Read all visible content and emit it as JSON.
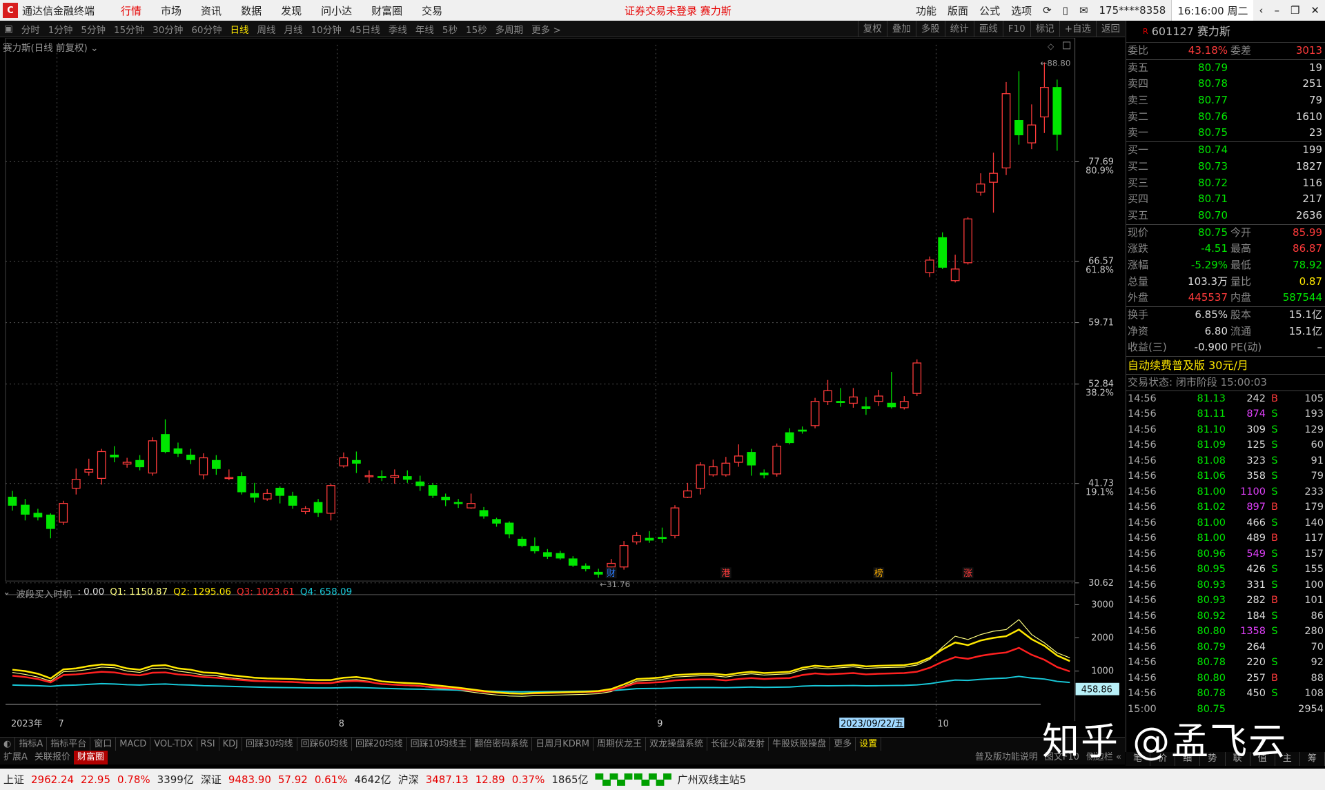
{
  "title": {
    "app_name": "通达信金融终端",
    "menu": [
      "行情",
      "市场",
      "资讯",
      "数据",
      "发现",
      "问小达",
      "财富圈",
      "交易"
    ],
    "active_menu": "行情",
    "notice": "证券交易未登录  赛力斯",
    "right_menu": [
      "功能",
      "版面",
      "公式",
      "选项"
    ],
    "account": "175****8358",
    "clock": "16:16:00 周二"
  },
  "periods": [
    "分时",
    "1分钟",
    "5分钟",
    "15分钟",
    "30分钟",
    "60分钟",
    "日线",
    "周线",
    "月线",
    "10分钟",
    "45日线",
    "季线",
    "年线",
    "5秒",
    "15秒",
    "多周期",
    "更多 >"
  ],
  "active_period": "日线",
  "chart_buttons": [
    "复权",
    "叠加",
    "多股",
    "统计",
    "画线",
    "F10",
    "标记",
    "+自选",
    "返回"
  ],
  "main_legend": "赛力斯(日线 前复权)",
  "indicator_legend": {
    "name": "波段买入时机",
    "v0": ": 0.00",
    "q1": "Q1: 1150.87",
    "q2": "Q2: 1295.06",
    "q3": "Q3: 1023.61",
    "q4": "Q4: 658.09"
  },
  "colors": {
    "up": "#ff3b3b",
    "down": "#00e600",
    "q1": "#ffff80",
    "q2": "#ffe800",
    "q3": "#ff2020",
    "q4": "#18c8d8"
  },
  "stock": {
    "code": "601127",
    "name": "赛力斯",
    "weibi_label": "委比",
    "weibi": "43.18%",
    "weicha_label": "委差",
    "weicha": "3013",
    "asks": [
      {
        "label": "卖五",
        "price": "80.79",
        "vol": "19"
      },
      {
        "label": "卖四",
        "price": "80.78",
        "vol": "251"
      },
      {
        "label": "卖三",
        "price": "80.77",
        "vol": "79"
      },
      {
        "label": "卖二",
        "price": "80.76",
        "vol": "1610"
      },
      {
        "label": "卖一",
        "price": "80.75",
        "vol": "23"
      }
    ],
    "bids": [
      {
        "label": "买一",
        "price": "80.74",
        "vol": "199"
      },
      {
        "label": "买二",
        "price": "80.73",
        "vol": "1827"
      },
      {
        "label": "买三",
        "price": "80.72",
        "vol": "116"
      },
      {
        "label": "买四",
        "price": "80.71",
        "vol": "217"
      },
      {
        "label": "买五",
        "price": "80.70",
        "vol": "2636"
      }
    ],
    "stats": [
      {
        "l1": "现价",
        "v1": "80.75",
        "c1": "g",
        "l2": "今开",
        "v2": "85.99",
        "c2": "r"
      },
      {
        "l1": "涨跌",
        "v1": "-4.51",
        "c1": "g",
        "l2": "最高",
        "v2": "86.87",
        "c2": "r"
      },
      {
        "l1": "涨幅",
        "v1": "-5.29%",
        "c1": "g",
        "l2": "最低",
        "v2": "78.92",
        "c2": "g"
      },
      {
        "l1": "总量",
        "v1": "103.3万",
        "c1": "w",
        "l2": "量比",
        "v2": "0.87",
        "c2": "y"
      },
      {
        "l1": "外盘",
        "v1": "445537",
        "c1": "r",
        "l2": "内盘",
        "v2": "587544",
        "c2": "g"
      }
    ],
    "stats2": [
      {
        "l1": "换手",
        "v1": "6.85%",
        "c1": "w",
        "l2": "股本",
        "v2": "15.1亿",
        "c2": "w"
      },
      {
        "l1": "净资",
        "v1": "6.80",
        "c1": "w",
        "l2": "流通",
        "v2": "15.1亿",
        "c2": "w"
      },
      {
        "l1": "收益(三)",
        "v1": "-0.900",
        "c1": "w",
        "l2": "PE(动)",
        "v2": "–",
        "c2": "w"
      }
    ],
    "promo": "自动续费普及版  30元/月",
    "trade_status": "交易状态: 闭市阶段 15:00:03"
  },
  "ticks": [
    {
      "t": "14:56",
      "p": "81.13",
      "v": "242",
      "s": "B",
      "n": "105",
      "pc": "g",
      "vc": "w"
    },
    {
      "t": "14:56",
      "p": "81.11",
      "v": "874",
      "s": "S",
      "n": "193",
      "pc": "g",
      "vc": "m"
    },
    {
      "t": "14:56",
      "p": "81.10",
      "v": "309",
      "s": "S",
      "n": "129",
      "pc": "g",
      "vc": "w"
    },
    {
      "t": "14:56",
      "p": "81.09",
      "v": "125",
      "s": "S",
      "n": "60",
      "pc": "g",
      "vc": "w"
    },
    {
      "t": "14:56",
      "p": "81.08",
      "v": "323",
      "s": "S",
      "n": "91",
      "pc": "g",
      "vc": "w"
    },
    {
      "t": "14:56",
      "p": "81.06",
      "v": "358",
      "s": "S",
      "n": "79",
      "pc": "g",
      "vc": "w"
    },
    {
      "t": "14:56",
      "p": "81.00",
      "v": "1100",
      "s": "S",
      "n": "233",
      "pc": "g",
      "vc": "m"
    },
    {
      "t": "14:56",
      "p": "81.02",
      "v": "897",
      "s": "B",
      "n": "179",
      "pc": "g",
      "vc": "m"
    },
    {
      "t": "14:56",
      "p": "81.00",
      "v": "466",
      "s": "S",
      "n": "140",
      "pc": "g",
      "vc": "w"
    },
    {
      "t": "14:56",
      "p": "81.00",
      "v": "489",
      "s": "B",
      "n": "117",
      "pc": "g",
      "vc": "w"
    },
    {
      "t": "14:56",
      "p": "80.96",
      "v": "549",
      "s": "S",
      "n": "157",
      "pc": "g",
      "vc": "m"
    },
    {
      "t": "14:56",
      "p": "80.95",
      "v": "426",
      "s": "S",
      "n": "155",
      "pc": "g",
      "vc": "w"
    },
    {
      "t": "14:56",
      "p": "80.93",
      "v": "331",
      "s": "S",
      "n": "100",
      "pc": "g",
      "vc": "w"
    },
    {
      "t": "14:56",
      "p": "80.93",
      "v": "282",
      "s": "B",
      "n": "101",
      "pc": "g",
      "vc": "w"
    },
    {
      "t": "14:56",
      "p": "80.92",
      "v": "184",
      "s": "S",
      "n": "86",
      "pc": "g",
      "vc": "w"
    },
    {
      "t": "14:56",
      "p": "80.80",
      "v": "1358",
      "s": "S",
      "n": "280",
      "pc": "g",
      "vc": "m"
    },
    {
      "t": "14:56",
      "p": "80.79",
      "v": "264",
      "s": "",
      "n": "70",
      "pc": "g",
      "vc": "w"
    },
    {
      "t": "14:56",
      "p": "80.78",
      "v": "220",
      "s": "S",
      "n": "92",
      "pc": "g",
      "vc": "w"
    },
    {
      "t": "14:56",
      "p": "80.80",
      "v": "257",
      "s": "B",
      "n": "88",
      "pc": "g",
      "vc": "w"
    },
    {
      "t": "14:56",
      "p": "80.78",
      "v": "450",
      "s": "S",
      "n": "108",
      "pc": "g",
      "vc": "w"
    },
    {
      "t": "15:00",
      "p": "80.75",
      "v": "",
      "s": "",
      "n": "2954",
      "pc": "g",
      "vc": "w"
    }
  ],
  "indicator_tabs": [
    "指标A",
    "指标平台",
    "窗口",
    "MACD",
    "VOL-TDX",
    "RSI",
    "KDJ",
    "回踩30均线",
    "回踩60均线",
    "回踩20均线",
    "回踩10均线主",
    "翻倍密码系统",
    "日周月KDRM",
    "周期伏龙王",
    "双龙操盘系统",
    "长征火箭发射",
    "牛股妖股操盘",
    "更多",
    "设置"
  ],
  "tabbar2": [
    "扩展A",
    "关联报价",
    "财富圈"
  ],
  "tabbar2_right": [
    "普及版功能说明",
    "图文F10",
    "侧边栏 «"
  ],
  "right_tabs": [
    "笔",
    "价",
    "细",
    "势",
    "联",
    "值",
    "主",
    "筹"
  ],
  "status": {
    "sh_label": "上证",
    "sh": "2962.24",
    "sh_ch": "22.95",
    "sh_pct": "0.78%",
    "sh_amt": "3399亿",
    "sz_label": "深证",
    "sz": "9483.90",
    "sz_ch": "57.92",
    "sz_pct": "0.61%",
    "sz_amt": "4642亿",
    "hs_label": "沪深",
    "hs": "3487.13",
    "hs_ch": "12.89",
    "hs_pct": "0.37%",
    "hs_amt": "1865亿",
    "server": "广州双线主站5"
  },
  "watermark": "知乎 @孟飞云",
  "chart_data": {
    "type": "candlestick",
    "price_axis_ticks": [
      {
        "price": "77.69",
        "pct": "80.9%"
      },
      {
        "price": "66.57",
        "pct": "61.8%"
      },
      {
        "price": "59.71",
        "pct": ""
      },
      {
        "price": "52.84",
        "pct": "38.2%"
      },
      {
        "price": "41.73",
        "pct": "19.1%"
      },
      {
        "price": "30.62",
        "pct": ""
      }
    ],
    "ylim": [
      29.3,
      90.0
    ],
    "high_label": "88.80",
    "low_label": "31.76",
    "x_labels": [
      "2023年",
      "7",
      "8",
      "9",
      "10"
    ],
    "cursor_date": "2023/09/22/五",
    "markers": [
      {
        "i": 47,
        "text": "财",
        "color": "#2c7cff"
      },
      {
        "i": 56,
        "text": "港",
        "color": "#ff3b3b"
      },
      {
        "i": 68,
        "text": "榜",
        "color": "#ffb000"
      },
      {
        "i": 75,
        "text": "涨",
        "color": "#ff3b3b"
      }
    ],
    "candles": [
      [
        40.2,
        39.3,
        40.9,
        38.7
      ],
      [
        39.3,
        38.3,
        40.0,
        37.6
      ],
      [
        38.4,
        38.0,
        38.9,
        37.6
      ],
      [
        38.2,
        36.7,
        38.4,
        35.6
      ],
      [
        37.4,
        39.5,
        39.8,
        37.1
      ],
      [
        41.2,
        42.2,
        43.4,
        40.5
      ],
      [
        43.0,
        43.3,
        44.5,
        42.6
      ],
      [
        42.3,
        45.3,
        45.6,
        41.6
      ],
      [
        44.9,
        44.7,
        45.9,
        44.1
      ],
      [
        43.9,
        44.1,
        44.6,
        43.5
      ],
      [
        44.3,
        43.6,
        44.9,
        43.2
      ],
      [
        42.9,
        46.5,
        46.9,
        42.6
      ],
      [
        47.2,
        45.3,
        48.9,
        45.1
      ],
      [
        45.6,
        45.1,
        46.3,
        44.7
      ],
      [
        44.9,
        44.4,
        45.6,
        43.9
      ],
      [
        42.7,
        44.6,
        45.1,
        42.2
      ],
      [
        44.3,
        43.4,
        44.9,
        42.7
      ],
      [
        42.3,
        42.4,
        43.3,
        42.1
      ],
      [
        42.5,
        40.8,
        43.0,
        40.5
      ],
      [
        40.6,
        40.2,
        41.8,
        39.6
      ],
      [
        40.0,
        40.6,
        41.1,
        39.8
      ],
      [
        41.2,
        40.4,
        41.4,
        39.5
      ],
      [
        40.3,
        39.3,
        40.8,
        38.9
      ],
      [
        38.6,
        38.9,
        39.2,
        38.3
      ],
      [
        39.6,
        38.5,
        40.0,
        38.0
      ],
      [
        38.4,
        41.5,
        41.7,
        37.6
      ],
      [
        43.7,
        44.6,
        45.2,
        43.5
      ],
      [
        44.3,
        44.0,
        45.3,
        42.9
      ],
      [
        42.6,
        42.6,
        43.2,
        41.8
      ],
      [
        42.5,
        42.4,
        43.2,
        42.0
      ],
      [
        42.4,
        42.6,
        43.3,
        41.7
      ],
      [
        42.5,
        42.2,
        43.2,
        41.8
      ],
      [
        41.9,
        41.5,
        42.6,
        40.9
      ],
      [
        41.5,
        40.4,
        41.8,
        40.1
      ],
      [
        40.2,
        39.9,
        40.6,
        39.2
      ],
      [
        39.6,
        39.5,
        40.0,
        39.0
      ],
      [
        39.0,
        39.5,
        40.6,
        38.9
      ],
      [
        38.7,
        38.1,
        39.1,
        37.8
      ],
      [
        37.7,
        37.3,
        37.9,
        36.9
      ],
      [
        37.3,
        36.1,
        37.5,
        35.6
      ],
      [
        35.5,
        34.8,
        35.8,
        34.6
      ],
      [
        34.7,
        34.2,
        35.7,
        33.9
      ],
      [
        34.0,
        33.6,
        34.4,
        33.3
      ],
      [
        33.9,
        33.4,
        34.2,
        33.2
      ],
      [
        33.3,
        32.6,
        33.6,
        32.4
      ],
      [
        32.5,
        32.2,
        32.8,
        31.9
      ],
      [
        31.8,
        31.6,
        32.2,
        31.2
      ],
      [
        32.4,
        32.8,
        33.3,
        32.3
      ],
      [
        32.4,
        34.8,
        35.3,
        32.1
      ],
      [
        35.2,
        35.9,
        36.3,
        34.9
      ],
      [
        35.6,
        35.4,
        36.4,
        35.1
      ],
      [
        35.7,
        35.6,
        36.8,
        35.1
      ],
      [
        35.9,
        39.0,
        39.3,
        35.6
      ],
      [
        40.2,
        40.9,
        41.8,
        40.1
      ],
      [
        41.2,
        43.8,
        44.1,
        40.5
      ],
      [
        42.7,
        43.6,
        44.4,
        42.5
      ],
      [
        42.7,
        44.0,
        44.7,
        42.5
      ],
      [
        44.1,
        44.8,
        46.1,
        43.6
      ],
      [
        45.2,
        43.8,
        45.6,
        42.6
      ],
      [
        42.9,
        42.7,
        43.3,
        42.3
      ],
      [
        42.8,
        45.9,
        46.2,
        42.5
      ],
      [
        47.4,
        46.3,
        47.9,
        46.1
      ],
      [
        47.7,
        47.6,
        48.1,
        47.3
      ],
      [
        48.2,
        50.9,
        51.3,
        47.9
      ],
      [
        50.9,
        52.1,
        53.3,
        50.5
      ],
      [
        50.9,
        50.8,
        52.4,
        50.3
      ],
      [
        50.7,
        51.4,
        52.4,
        50.2
      ],
      [
        50.3,
        50.1,
        51.4,
        49.4
      ],
      [
        50.9,
        51.5,
        52.2,
        50.4
      ],
      [
        50.7,
        50.3,
        54.2,
        50.1
      ],
      [
        50.2,
        50.9,
        51.5,
        50.0
      ],
      [
        51.8,
        55.2,
        55.6,
        51.5
      ],
      [
        65.3,
        66.7,
        67.1,
        64.8
      ],
      [
        69.2,
        65.9,
        69.8,
        65.7
      ],
      [
        64.4,
        65.7,
        67.3,
        64.2
      ],
      [
        66.4,
        71.3,
        71.5,
        66.2
      ],
      [
        74.3,
        75.2,
        76.4,
        73.9
      ],
      [
        75.4,
        76.4,
        78.7,
        72.0
      ],
      [
        77.0,
        85.3,
        86.6,
        76.2
      ],
      [
        82.3,
        80.7,
        87.8,
        79.6
      ],
      [
        79.8,
        81.8,
        84.1,
        79.1
      ],
      [
        82.7,
        86.0,
        88.8,
        80.9
      ],
      [
        85.99,
        80.75,
        86.87,
        78.92
      ]
    ],
    "indicator": {
      "ylim": [
        -300,
        3300
      ],
      "ticks": [
        3000,
        2000,
        1000
      ],
      "current_label": "458.86",
      "q1": [
        960,
        900,
        820,
        700,
        980,
        1000,
        1050,
        1120,
        1100,
        1000,
        960,
        1080,
        1090,
        1000,
        950,
        880,
        860,
        800,
        760,
        720,
        700,
        690,
        680,
        660,
        650,
        650,
        720,
        740,
        690,
        610,
        580,
        560,
        540,
        500,
        460,
        420,
        370,
        320,
        280,
        250,
        240,
        260,
        270,
        280,
        290,
        300,
        320,
        380,
        540,
        700,
        720,
        750,
        820,
        840,
        860,
        860,
        820,
        880,
        920,
        880,
        900,
        920,
        1040,
        1100,
        1070,
        1100,
        1130,
        1080,
        1100,
        1110,
        1120,
        1180,
        1350,
        1720,
        2050,
        1950,
        2100,
        2200,
        2250,
        2550,
        2100,
        1850,
        1550,
        1400
      ],
      "q2": [
        1040,
        1000,
        920,
        780,
        1050,
        1080,
        1150,
        1200,
        1180,
        1080,
        1040,
        1160,
        1180,
        1080,
        1040,
        960,
        940,
        880,
        840,
        800,
        780,
        770,
        760,
        740,
        730,
        730,
        800,
        820,
        770,
        690,
        660,
        640,
        620,
        580,
        540,
        500,
        450,
        400,
        360,
        330,
        320,
        340,
        350,
        360,
        370,
        380,
        400,
        460,
        600,
        760,
        780,
        810,
        880,
        900,
        920,
        920,
        880,
        940,
        980,
        940,
        960,
        980,
        1100,
        1160,
        1130,
        1160,
        1190,
        1140,
        1160,
        1170,
        1180,
        1240,
        1400,
        1650,
        1860,
        1780,
        1920,
        2000,
        2050,
        2250,
        1960,
        1760,
        1470,
        1300
      ],
      "q3": [
        860,
        820,
        760,
        660,
        880,
        900,
        940,
        980,
        960,
        900,
        870,
        950,
        960,
        900,
        870,
        820,
        800,
        760,
        730,
        700,
        690,
        680,
        670,
        650,
        640,
        640,
        690,
        700,
        670,
        610,
        590,
        570,
        550,
        520,
        490,
        460,
        420,
        380,
        350,
        330,
        320,
        330,
        340,
        350,
        360,
        370,
        380,
        420,
        520,
        640,
        650,
        670,
        720,
        740,
        750,
        750,
        720,
        760,
        790,
        760,
        780,
        790,
        880,
        930,
        900,
        920,
        940,
        900,
        920,
        930,
        940,
        980,
        1100,
        1280,
        1420,
        1370,
        1460,
        1520,
        1560,
        1700,
        1490,
        1340,
        1120,
        990
      ],
      "q4": [
        580,
        570,
        560,
        540,
        570,
        580,
        600,
        620,
        610,
        590,
        580,
        600,
        610,
        590,
        580,
        560,
        550,
        540,
        530,
        520,
        510,
        505,
        500,
        495,
        490,
        490,
        500,
        505,
        495,
        480,
        470,
        460,
        455,
        445,
        435,
        425,
        415,
        400,
        390,
        380,
        375,
        378,
        382,
        386,
        390,
        394,
        400,
        410,
        440,
        470,
        475,
        480,
        495,
        500,
        505,
        505,
        500,
        510,
        520,
        510,
        515,
        520,
        545,
        560,
        555,
        560,
        565,
        555,
        560,
        565,
        570,
        585,
        620,
        680,
        730,
        720,
        750,
        775,
        790,
        840,
        790,
        760,
        690,
        658
      ]
    }
  }
}
